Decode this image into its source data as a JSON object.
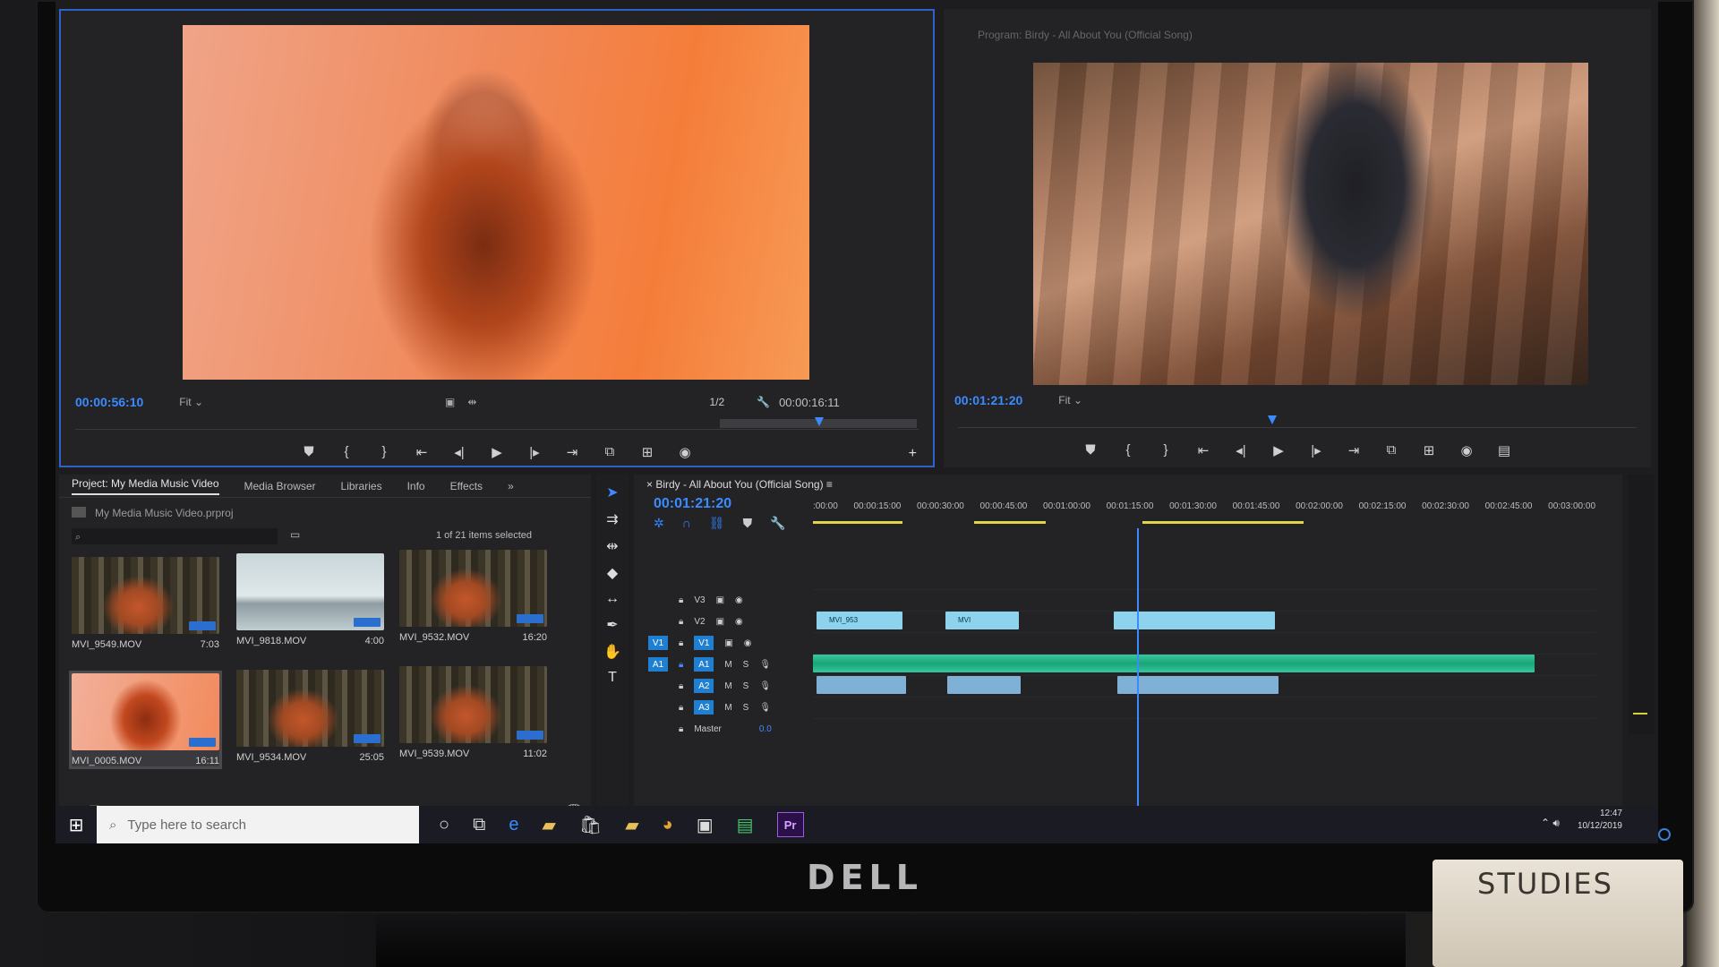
{
  "source_monitor": {
    "timecode": "00:00:56:10",
    "fit": "Fit",
    "resolution": "1/2",
    "duration": "00:00:16:11"
  },
  "program_monitor": {
    "title": "Program: Birdy - All About You (Official Song)",
    "timecode": "00:01:21:20",
    "fit": "Fit"
  },
  "project": {
    "tabs": [
      "Project: My Media Music Video",
      "Media Browser",
      "Libraries",
      "Info",
      "Effects"
    ],
    "file": "My Media Music Video.prproj",
    "selection": "1 of 21 items selected",
    "clips": [
      {
        "name": "MVI_9549.MOV",
        "duration": "7:03"
      },
      {
        "name": "MVI_9818.MOV",
        "duration": "4:00"
      },
      {
        "name": "MVI_9532.MOV",
        "duration": "16:20"
      },
      {
        "name": "MVI_0005.MOV",
        "duration": "16:11"
      },
      {
        "name": "MVI_9534.MOV",
        "duration": "25:05"
      },
      {
        "name": "MVI_9539.MOV",
        "duration": "11:02"
      }
    ]
  },
  "timeline": {
    "title": "Birdy - All About You (Official Song)",
    "timecode": "00:01:21:20",
    "ruler": [
      ":00:00",
      "00:00:15:00",
      "00:00:30:00",
      "00:00:45:00",
      "00:01:00:00",
      "00:01:15:00",
      "00:01:30:00",
      "00:01:45:00",
      "00:02:00:00",
      "00:02:15:00",
      "00:02:30:00",
      "00:02:45:00",
      "00:03:00:00"
    ],
    "tracks": {
      "v3": "V3",
      "v2": "V2",
      "v1": "V1",
      "a1": "A1",
      "a2": "A2",
      "a3": "A3",
      "master": "Master",
      "master_level": "0.0",
      "src_v": "V1",
      "src_a": "A1"
    },
    "clip_labels": [
      "MVI_953",
      "MVI"
    ]
  },
  "taskbar": {
    "search_placeholder": "Type here to search",
    "time": "12:47",
    "date": "10/12/2019",
    "premiere": "Pr"
  },
  "monitor": {
    "brand": "DELL",
    "box_text": "STUDIES"
  }
}
